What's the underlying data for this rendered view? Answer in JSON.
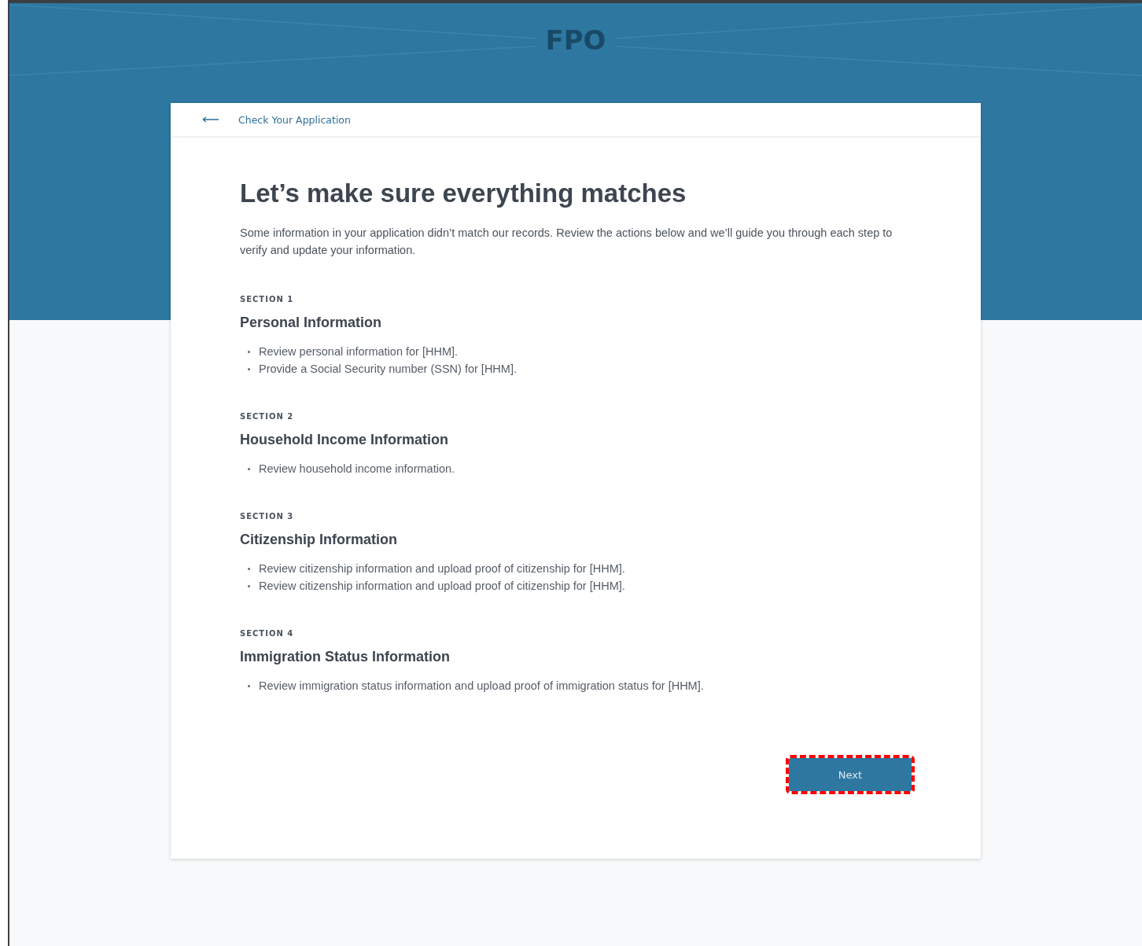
{
  "banner": {
    "placeholder_label": "FPO"
  },
  "nav": {
    "back_label": "Check Your Application"
  },
  "title": "Let’s make sure everything matches",
  "intro": "Some information in your application didn’t match our records. Review the actions below and we’ll guide you through each step to verify and update your information.",
  "sections": [
    {
      "eyebrow": "SECTION 1",
      "heading": "Personal Information",
      "items": [
        "Review personal information for [HHM].",
        "Provide a Social Security number (SSN) for [HHM]."
      ]
    },
    {
      "eyebrow": "SECTION 2",
      "heading": "Household Income Information",
      "items": [
        "Review household income information."
      ]
    },
    {
      "eyebrow": "SECTION 3",
      "heading": "Citizenship Information",
      "items": [
        "Review citizenship information and upload proof of citizenship for [HHM].",
        "Review citizenship information and upload proof of citizenship for [HHM]."
      ]
    },
    {
      "eyebrow": "SECTION 4",
      "heading": "Immigration Status Information",
      "items": [
        "Review immigration status information and upload proof of immigration status for [HHM]."
      ]
    }
  ],
  "next_button": {
    "label": "Next",
    "highlighted": true
  }
}
